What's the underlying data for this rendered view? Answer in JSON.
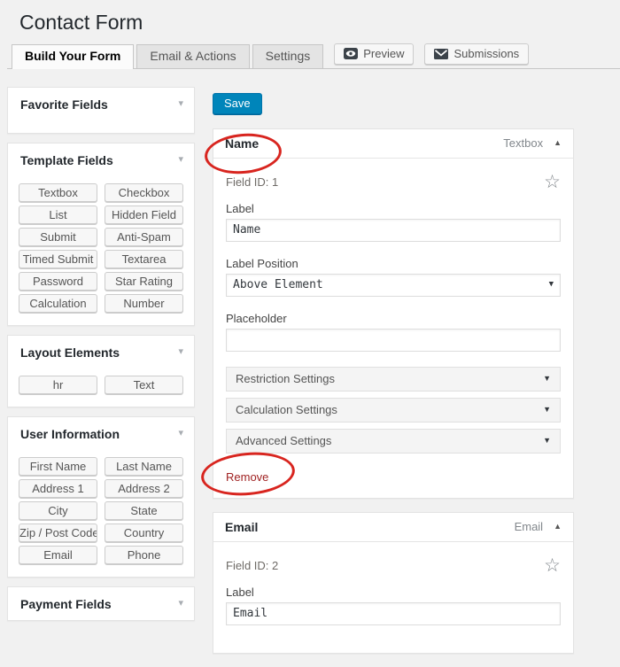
{
  "page": {
    "title": "Contact Form"
  },
  "tabs": {
    "build": "Build Your Form",
    "email_actions": "Email & Actions",
    "settings": "Settings"
  },
  "toolbar": {
    "preview": "Preview",
    "submissions": "Submissions"
  },
  "main": {
    "save": "Save"
  },
  "sidebar": {
    "panels": [
      {
        "title": "Favorite Fields",
        "buttons": []
      },
      {
        "title": "Template Fields",
        "buttons": [
          "Textbox",
          "Checkbox",
          "List",
          "Hidden Field",
          "Submit",
          "Anti-Spam",
          "Timed Submit",
          "Textarea",
          "Password",
          "Star Rating",
          "Calculation",
          "Number"
        ]
      },
      {
        "title": "Layout Elements",
        "buttons": [
          "hr",
          "Text"
        ]
      },
      {
        "title": "User Information",
        "buttons": [
          "First Name",
          "Last Name",
          "Address 1",
          "Address 2",
          "City",
          "State",
          "Zip / Post Code",
          "Country",
          "Email",
          "Phone"
        ]
      },
      {
        "title": "Payment Fields",
        "buttons": []
      }
    ]
  },
  "fields": [
    {
      "title": "Name",
      "type": "Textbox",
      "field_id": "Field ID: 1",
      "label": {
        "caption": "Label",
        "value": "Name"
      },
      "label_position": {
        "caption": "Label Position",
        "value": "Above Element"
      },
      "placeholder": {
        "caption": "Placeholder",
        "value": ""
      },
      "accordions": [
        "Restriction Settings",
        "Calculation Settings",
        "Advanced Settings"
      ],
      "remove": "Remove"
    },
    {
      "title": "Email",
      "type": "Email",
      "field_id": "Field ID: 2",
      "label": {
        "caption": "Label",
        "value": "Email"
      }
    }
  ],
  "colors": {
    "accent_blue": "#0085ba",
    "annotation_red": "#d8251f",
    "remove_red": "#a02222"
  }
}
